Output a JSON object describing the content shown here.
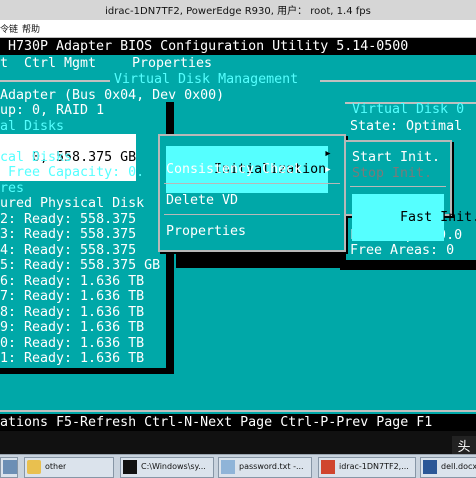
{
  "window": {
    "title": "idrac-1DN7TF2, PowerEdge R930, 用户： root, 1.4 fps"
  },
  "app_menu": {
    "items": [
      "令链",
      "帮助"
    ]
  },
  "bios": {
    "header": "H730P Adapter BIOS Configuration Utility 5.14-0500",
    "menu": [
      "t",
      "Ctrl Mgmt",
      "Properties"
    ],
    "panel_title": "Virtual Disk Management",
    "adapter_line": "Adapter (Bus 0x04, Dev 0x00)",
    "group_line": "up: 0, RAID 1",
    "virtual_disks_label": "al Disks",
    "vd_line": "0, 558.375 GB",
    "physical_disks_label": "cal Disks",
    "free_capacity_line": " Free Capacity: 0.",
    "res_label": "res",
    "configured_pd_label": "ured Physical Disk",
    "disks": [
      "2: Ready: 558.375",
      "3: Ready: 558.375",
      "4: Ready: 558.375",
      "5: Ready: 558.375 GB",
      "6: Ready: 1.636 TB",
      "7: Ready: 1.636 TB",
      "8: Ready: 1.636 TB",
      "9: Ready: 1.636 TB",
      "0: Ready: 1.636 TB",
      "1: Ready: 1.636 TB"
    ],
    "right_panel": {
      "title": "Virtual Disk 0",
      "state": "State: Optimal",
      "free_cap": "Free Cap.: 0.0",
      "free_areas": "Free Areas: 0"
    },
    "popup": {
      "items": [
        "Initialization",
        "Consistency Check",
        "Delete VD",
        "Properties"
      ],
      "arrow": "▸"
    },
    "submenu": {
      "items": [
        "Start Init.",
        "Stop Init.",
        "Fast Init."
      ]
    },
    "status_bar": "ations F5-Refresh Ctrl-N-Next Page Ctrl-P-Prev Page F1"
  },
  "taskbar": {
    "items": [
      "other",
      "C:\\Windows\\sy...",
      "password.txt -...",
      "idrac-1DN7TF2,...",
      "dell.docx"
    ]
  }
}
